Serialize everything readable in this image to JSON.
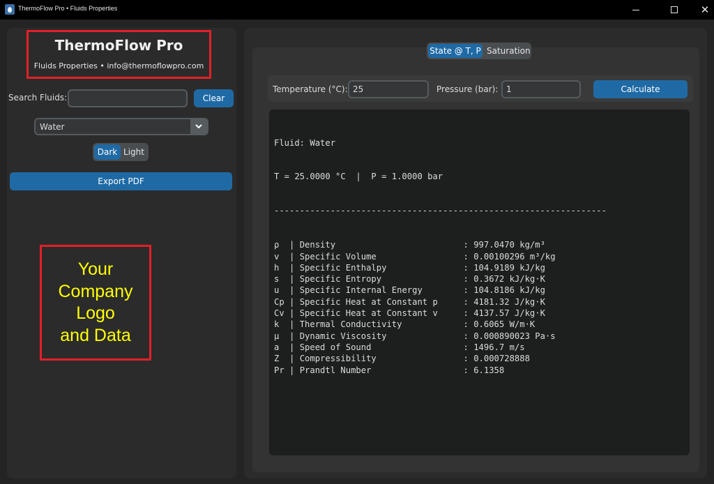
{
  "window": {
    "title": "ThermoFlow Pro • Fluids Properties",
    "controls": {
      "minimize": "—",
      "maximize": "☐",
      "close": "✕"
    }
  },
  "sidebar": {
    "brand_title": "ThermoFlow Pro",
    "brand_subtitle": "Fluids Properties • info@thermoflowpro.com",
    "search_label": "Search Fluids:",
    "search_value": "",
    "clear_label": "Clear",
    "fluid_selected": "Water",
    "theme_options": [
      "Dark",
      "Light"
    ],
    "theme_selected": "Dark",
    "export_label": "Export PDF",
    "logo_lines": [
      "Your",
      "Company",
      "Logo",
      "and Data"
    ]
  },
  "tabs": [
    {
      "label": "State @ T, P",
      "active": true
    },
    {
      "label": "Saturation",
      "active": false
    }
  ],
  "inputs": {
    "temperature_label": "Temperature (°C):",
    "temperature_value": "25",
    "pressure_label": "Pressure (bar):",
    "pressure_value": "1",
    "calculate_label": "Calculate"
  },
  "output": {
    "fluid_line": "Fluid: Water",
    "state_line": "T = 25.0000 °C  |  P = 1.0000 bar",
    "separator": "-----------------------------------------------------------------",
    "properties": [
      {
        "symbol": "ρ",
        "name": "Density",
        "value": "997.0470 kg/m³"
      },
      {
        "symbol": "v",
        "name": "Specific Volume",
        "value": "0.00100296 m³/kg"
      },
      {
        "symbol": "h",
        "name": "Specific Enthalpy",
        "value": "104.9189 kJ/kg"
      },
      {
        "symbol": "s",
        "name": "Specific Entropy",
        "value": "0.3672 kJ/kg·K"
      },
      {
        "symbol": "u",
        "name": "Specific Internal Energy",
        "value": "104.8186 kJ/kg"
      },
      {
        "symbol": "Cp",
        "name": "Specific Heat at Constant p",
        "value": "4181.32 J/kg·K"
      },
      {
        "symbol": "Cv",
        "name": "Specific Heat at Constant v",
        "value": "4137.57 J/kg·K"
      },
      {
        "symbol": "k",
        "name": "Thermal Conductivity",
        "value": "0.6065 W/m·K"
      },
      {
        "symbol": "μ",
        "name": "Dynamic Viscosity",
        "value": "0.000890023 Pa·s"
      },
      {
        "symbol": "a",
        "name": "Speed of Sound",
        "value": "1496.7 m/s"
      },
      {
        "symbol": "Z",
        "name": "Compressibility",
        "value": "0.000728888"
      },
      {
        "symbol": "Pr",
        "name": "Prandtl Number",
        "value": "6.1358"
      }
    ]
  },
  "colors": {
    "accent": "#1f6aa5",
    "highlight_border": "#e32028",
    "logo_text": "#ffff00"
  }
}
